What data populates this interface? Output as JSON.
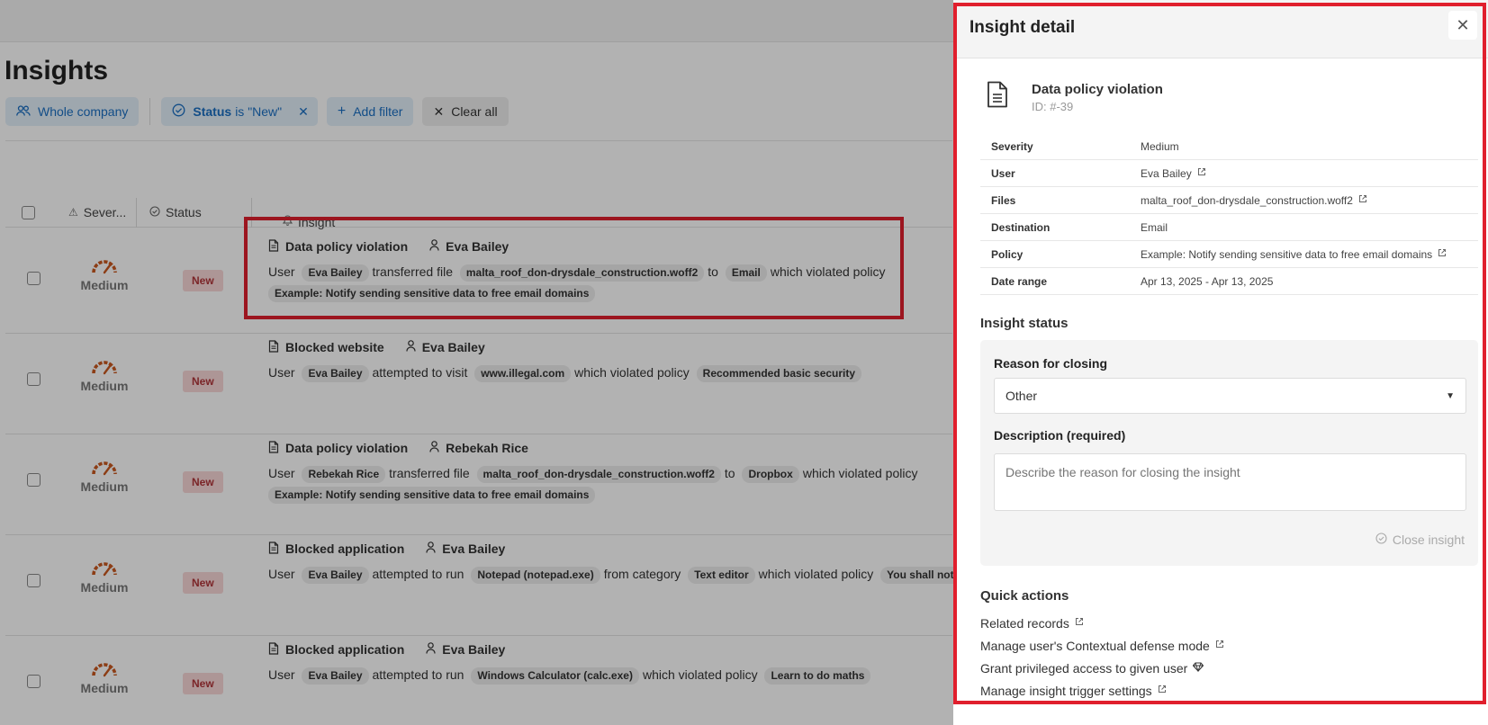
{
  "page": {
    "title": "Insights",
    "filters": {
      "scope": "Whole company",
      "status_key": "Status",
      "status_value": "is \"New\"",
      "add_filter": "Add filter",
      "clear_all": "Clear all"
    },
    "columns": {
      "severity": "Sever...",
      "status": "Status",
      "insight": "Insight"
    },
    "rows": [
      {
        "severity": "Medium",
        "status": "New",
        "title": "Data policy violation",
        "user": "Eva Bailey",
        "line": [
          [
            "t",
            "User"
          ],
          [
            "g",
            "Eva Bailey"
          ],
          [
            "t",
            "transferred file"
          ],
          [
            "g",
            "malta_roof_don-drysdale_construction.woff2"
          ],
          [
            "t",
            "to"
          ],
          [
            "g",
            "Email"
          ],
          [
            "t",
            "which violated policy"
          ]
        ],
        "line2": "Example: Notify sending sensitive data to free email domains"
      },
      {
        "severity": "Medium",
        "status": "New",
        "title": "Blocked website",
        "user": "Eva Bailey",
        "line": [
          [
            "t",
            "User"
          ],
          [
            "g",
            "Eva Bailey"
          ],
          [
            "t",
            "attempted to visit"
          ],
          [
            "g",
            "www.illegal.com"
          ],
          [
            "t",
            "which violated policy"
          ],
          [
            "g",
            "Recommended basic security"
          ]
        ],
        "line2": ""
      },
      {
        "severity": "Medium",
        "status": "New",
        "title": "Data policy violation",
        "user": "Rebekah Rice",
        "line": [
          [
            "t",
            "User"
          ],
          [
            "g",
            "Rebekah Rice"
          ],
          [
            "t",
            "transferred file"
          ],
          [
            "g",
            "malta_roof_don-drysdale_construction.woff2"
          ],
          [
            "t",
            "to"
          ],
          [
            "g",
            "Dropbox"
          ],
          [
            "t",
            "which violated policy"
          ]
        ],
        "line2": "Example: Notify sending sensitive data to free email domains"
      },
      {
        "severity": "Medium",
        "status": "New",
        "title": "Blocked application",
        "user": "Eva Bailey",
        "line": [
          [
            "t",
            "User"
          ],
          [
            "g",
            "Eva Bailey"
          ],
          [
            "t",
            "attempted to run"
          ],
          [
            "g",
            "Notepad (notepad.exe)"
          ],
          [
            "t",
            "from category"
          ],
          [
            "g",
            "Text editor"
          ],
          [
            "t",
            "which violated policy"
          ],
          [
            "g",
            "You shall not ty"
          ]
        ],
        "line2": ""
      },
      {
        "severity": "Medium",
        "status": "New",
        "title": "Blocked application",
        "user": "Eva Bailey",
        "line": [
          [
            "t",
            "User"
          ],
          [
            "g",
            "Eva Bailey"
          ],
          [
            "t",
            "attempted to run"
          ],
          [
            "g",
            "Windows Calculator (calc.exe)"
          ],
          [
            "t",
            "which violated policy"
          ],
          [
            "g",
            "Learn to do maths"
          ]
        ],
        "line2": ""
      }
    ]
  },
  "drawer": {
    "title": "Insight detail",
    "insight_name": "Data policy violation",
    "insight_id": "ID: #-39",
    "details": [
      {
        "key": "Severity",
        "value": "Medium",
        "link": false
      },
      {
        "key": "User",
        "value": "Eva Bailey",
        "link": true
      },
      {
        "key": "Files",
        "value": "malta_roof_don-drysdale_construction.woff2",
        "link": true
      },
      {
        "key": "Destination",
        "value": "Email",
        "link": false
      },
      {
        "key": "Policy",
        "value": "Example: Notify sending sensitive data to free email domains",
        "link": true
      },
      {
        "key": "Date range",
        "value": "Apr 13, 2025 - Apr 13, 2025",
        "link": false
      }
    ],
    "status_section": {
      "title": "Insight status",
      "reason_label": "Reason for closing",
      "reason_value": "Other",
      "description_label": "Description (required)",
      "description_placeholder": "Describe the reason for closing the insight",
      "close_button": "Close insight"
    },
    "quick_actions": {
      "title": "Quick actions",
      "items": [
        {
          "label": "Related records",
          "icon": "external-link-icon"
        },
        {
          "label": "Manage user's Contextual defense mode",
          "icon": "external-link-icon"
        },
        {
          "label": "Grant privileged access to given user",
          "icon": "premium-gem-icon"
        },
        {
          "label": "Manage insight trigger settings",
          "icon": "external-link-icon"
        }
      ]
    }
  },
  "colors": {
    "accent": "#1b6fc2",
    "highlight": "#e01f2d",
    "badge_bg": "#f8d7d7",
    "badge_text": "#b0353a",
    "gauge": "#c9581f"
  }
}
